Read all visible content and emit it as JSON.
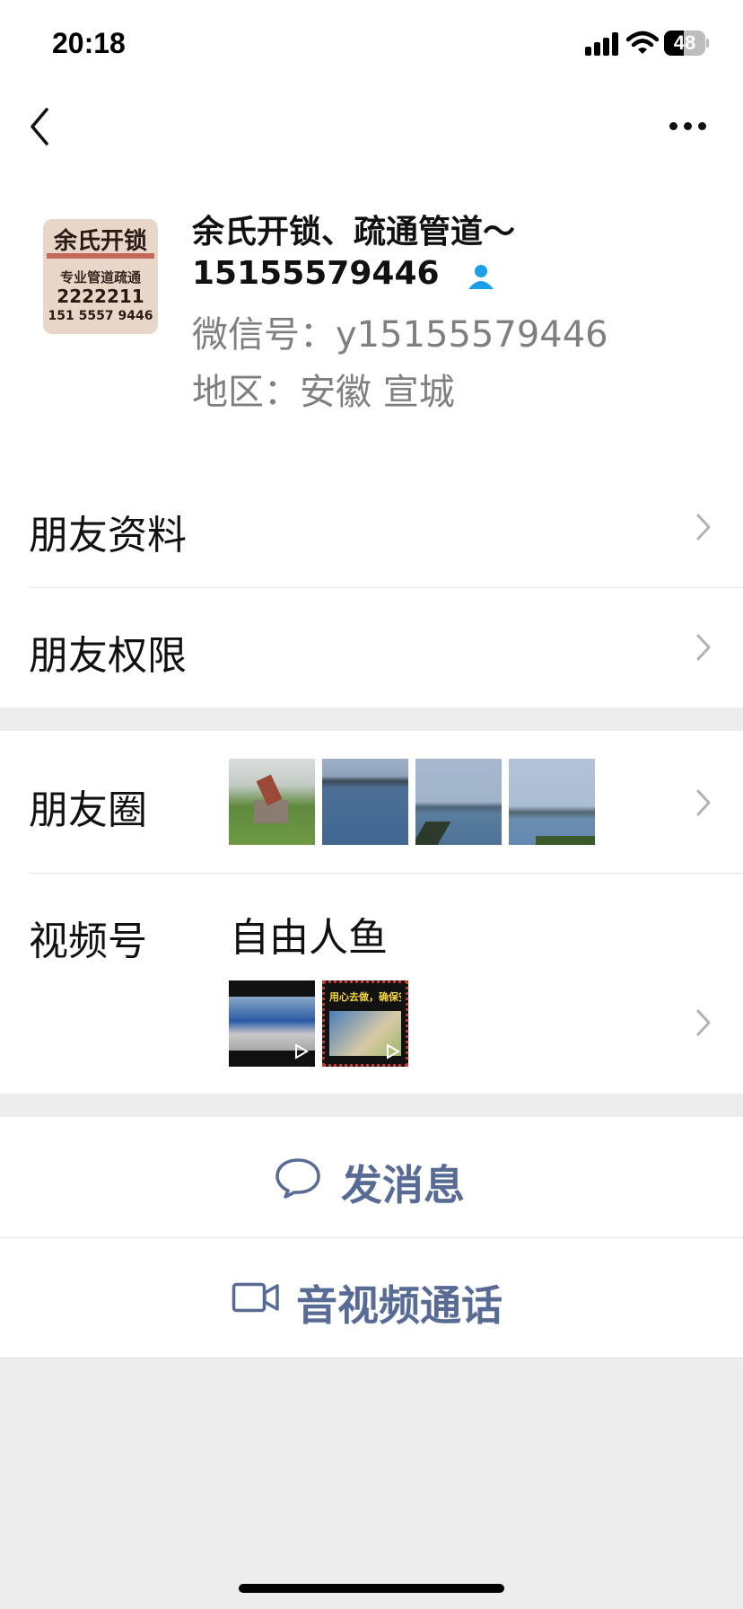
{
  "status_bar": {
    "time": "20:18",
    "battery": "48",
    "battery_level": 0.48
  },
  "profile": {
    "name_line1": "余氏开锁、疏通管道～",
    "name_line2": "15155579446",
    "wechat_id": "微信号：y15155579446",
    "region": "地区：安徽 宣城",
    "avatar_text": [
      "余氏开锁",
      "专业管道疏通",
      "2222211",
      "151 5557 9446"
    ]
  },
  "menu": {
    "friend_info": "朋友资料",
    "friend_permissions": "朋友权限",
    "moments": "朋友圈",
    "channels": "视频号",
    "channels_name": "自由人鱼"
  },
  "channel_thumb": {
    "caption": "用心去做，确保安全"
  },
  "actions": {
    "send_message": "发消息",
    "video_call": "音视频通话"
  },
  "colors": {
    "link": "#576b95",
    "secondary": "#7f7f7f",
    "accent_blue": "#1aa0e8"
  }
}
